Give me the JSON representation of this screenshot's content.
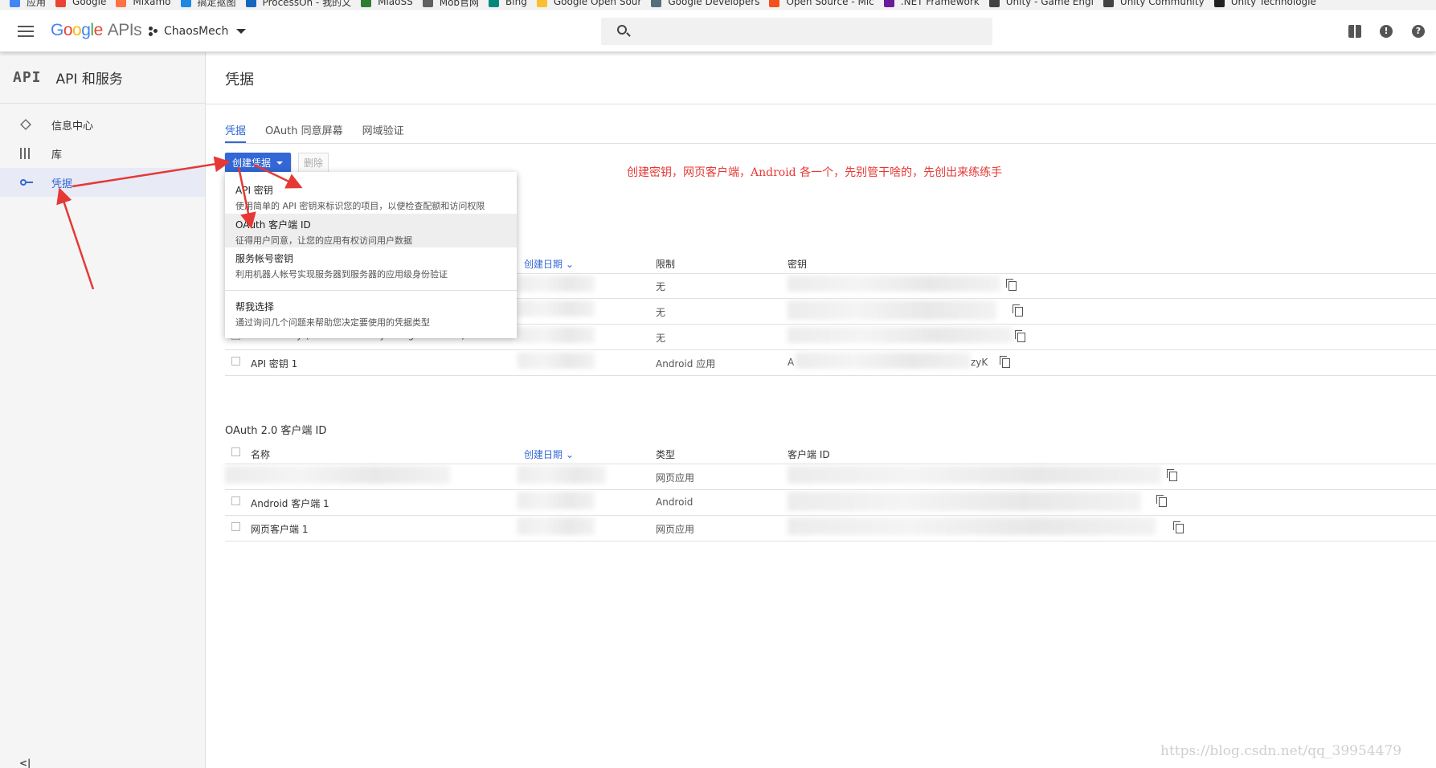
{
  "bookmarks": [
    {
      "label": "应用",
      "color": "#4285f4"
    },
    {
      "label": "Google",
      "color": "#ea4335"
    },
    {
      "label": "Mixamo",
      "color": "#ff7043"
    },
    {
      "label": "搞定抠图",
      "color": "#1e88e5"
    },
    {
      "label": "ProcessOn - 我的文",
      "color": "#1565c0"
    },
    {
      "label": "MiaoSS",
      "color": "#2e7d32"
    },
    {
      "label": "Mob官网",
      "color": "#616161"
    },
    {
      "label": "Bing",
      "color": "#00897b"
    },
    {
      "label": "Google Open Sour",
      "color": "#fbc02d"
    },
    {
      "label": "Google Developers",
      "color": "#546e7a"
    },
    {
      "label": "Open Source - Mic",
      "color": "#f4511e"
    },
    {
      "label": ".NET Framework",
      "color": "#6a1b9a"
    },
    {
      "label": "Unity - Game Engi",
      "color": "#424242"
    },
    {
      "label": "Unity Community",
      "color": "#424242"
    },
    {
      "label": "Unity Technologie",
      "color": "#212121"
    }
  ],
  "header": {
    "logo_letters": [
      "G",
      "o",
      "o",
      "g",
      "l",
      "e"
    ],
    "logo_suffix": "APIs",
    "project": "ChaosMech",
    "search_placeholder": ""
  },
  "sidebar": {
    "api_badge": "API",
    "title": "API 和服务",
    "items": [
      {
        "label": "信息中心",
        "icon": "dashboard-icon"
      },
      {
        "label": "库",
        "icon": "library-icon"
      },
      {
        "label": "凭据",
        "icon": "key-icon",
        "active": true
      }
    ],
    "collapse": "<|"
  },
  "page": {
    "title": "凭据",
    "tabs": [
      "凭据",
      "OAuth 同意屏幕",
      "网域验证"
    ],
    "create_button": "创建凭据",
    "delete_button": "删除",
    "annotation": "创建密钥，网页客户端，Android 各一个，先别管干啥的，先创出来练练手"
  },
  "menu": {
    "items": [
      {
        "title": "API 密钥",
        "desc": "使用简单的 API 密钥来标识您的项目，以便检查配额和访问权限"
      },
      {
        "title": "OAuth 客户端 ID",
        "desc": "征得用户同意，让您的应用有权访问用户数据"
      },
      {
        "title": "服务帐号密钥",
        "desc": "利用机器人帐号实现服务器到服务器的应用级身份验证"
      },
      {
        "title": "帮我选择",
        "desc": "通过询问几个问题来帮助您决定要使用的凭据类型"
      }
    ]
  },
  "api_keys": {
    "columns": {
      "date": "创建日期 ⌄",
      "restriction": "限制",
      "key": "密钥"
    },
    "row3_partial": "Server key (auto created by Google Service)",
    "rows": [
      {
        "restriction": "无"
      },
      {
        "restriction": "无"
      },
      {
        "restriction": "无"
      },
      {
        "name": "API 密钥 1",
        "restriction": "Android 应用",
        "key_prefix": "A",
        "key_suffix": "zyK"
      }
    ]
  },
  "oauth": {
    "title": "OAuth 2.0 客户端 ID",
    "columns": {
      "name": "名称",
      "date": "创建日期 ⌄",
      "type": "类型",
      "client_id": "客户端 ID"
    },
    "rows": [
      {
        "name": "",
        "type": "网页应用"
      },
      {
        "name": "Android 客户端 1",
        "type": "Android"
      },
      {
        "name": "网页客户端 1",
        "type": "网页应用"
      }
    ]
  },
  "watermark": "https://blog.csdn.net/qq_39954479",
  "colors": {
    "accent": "#3367d6",
    "annotation": "#e53935",
    "arrow": "#e53935"
  }
}
